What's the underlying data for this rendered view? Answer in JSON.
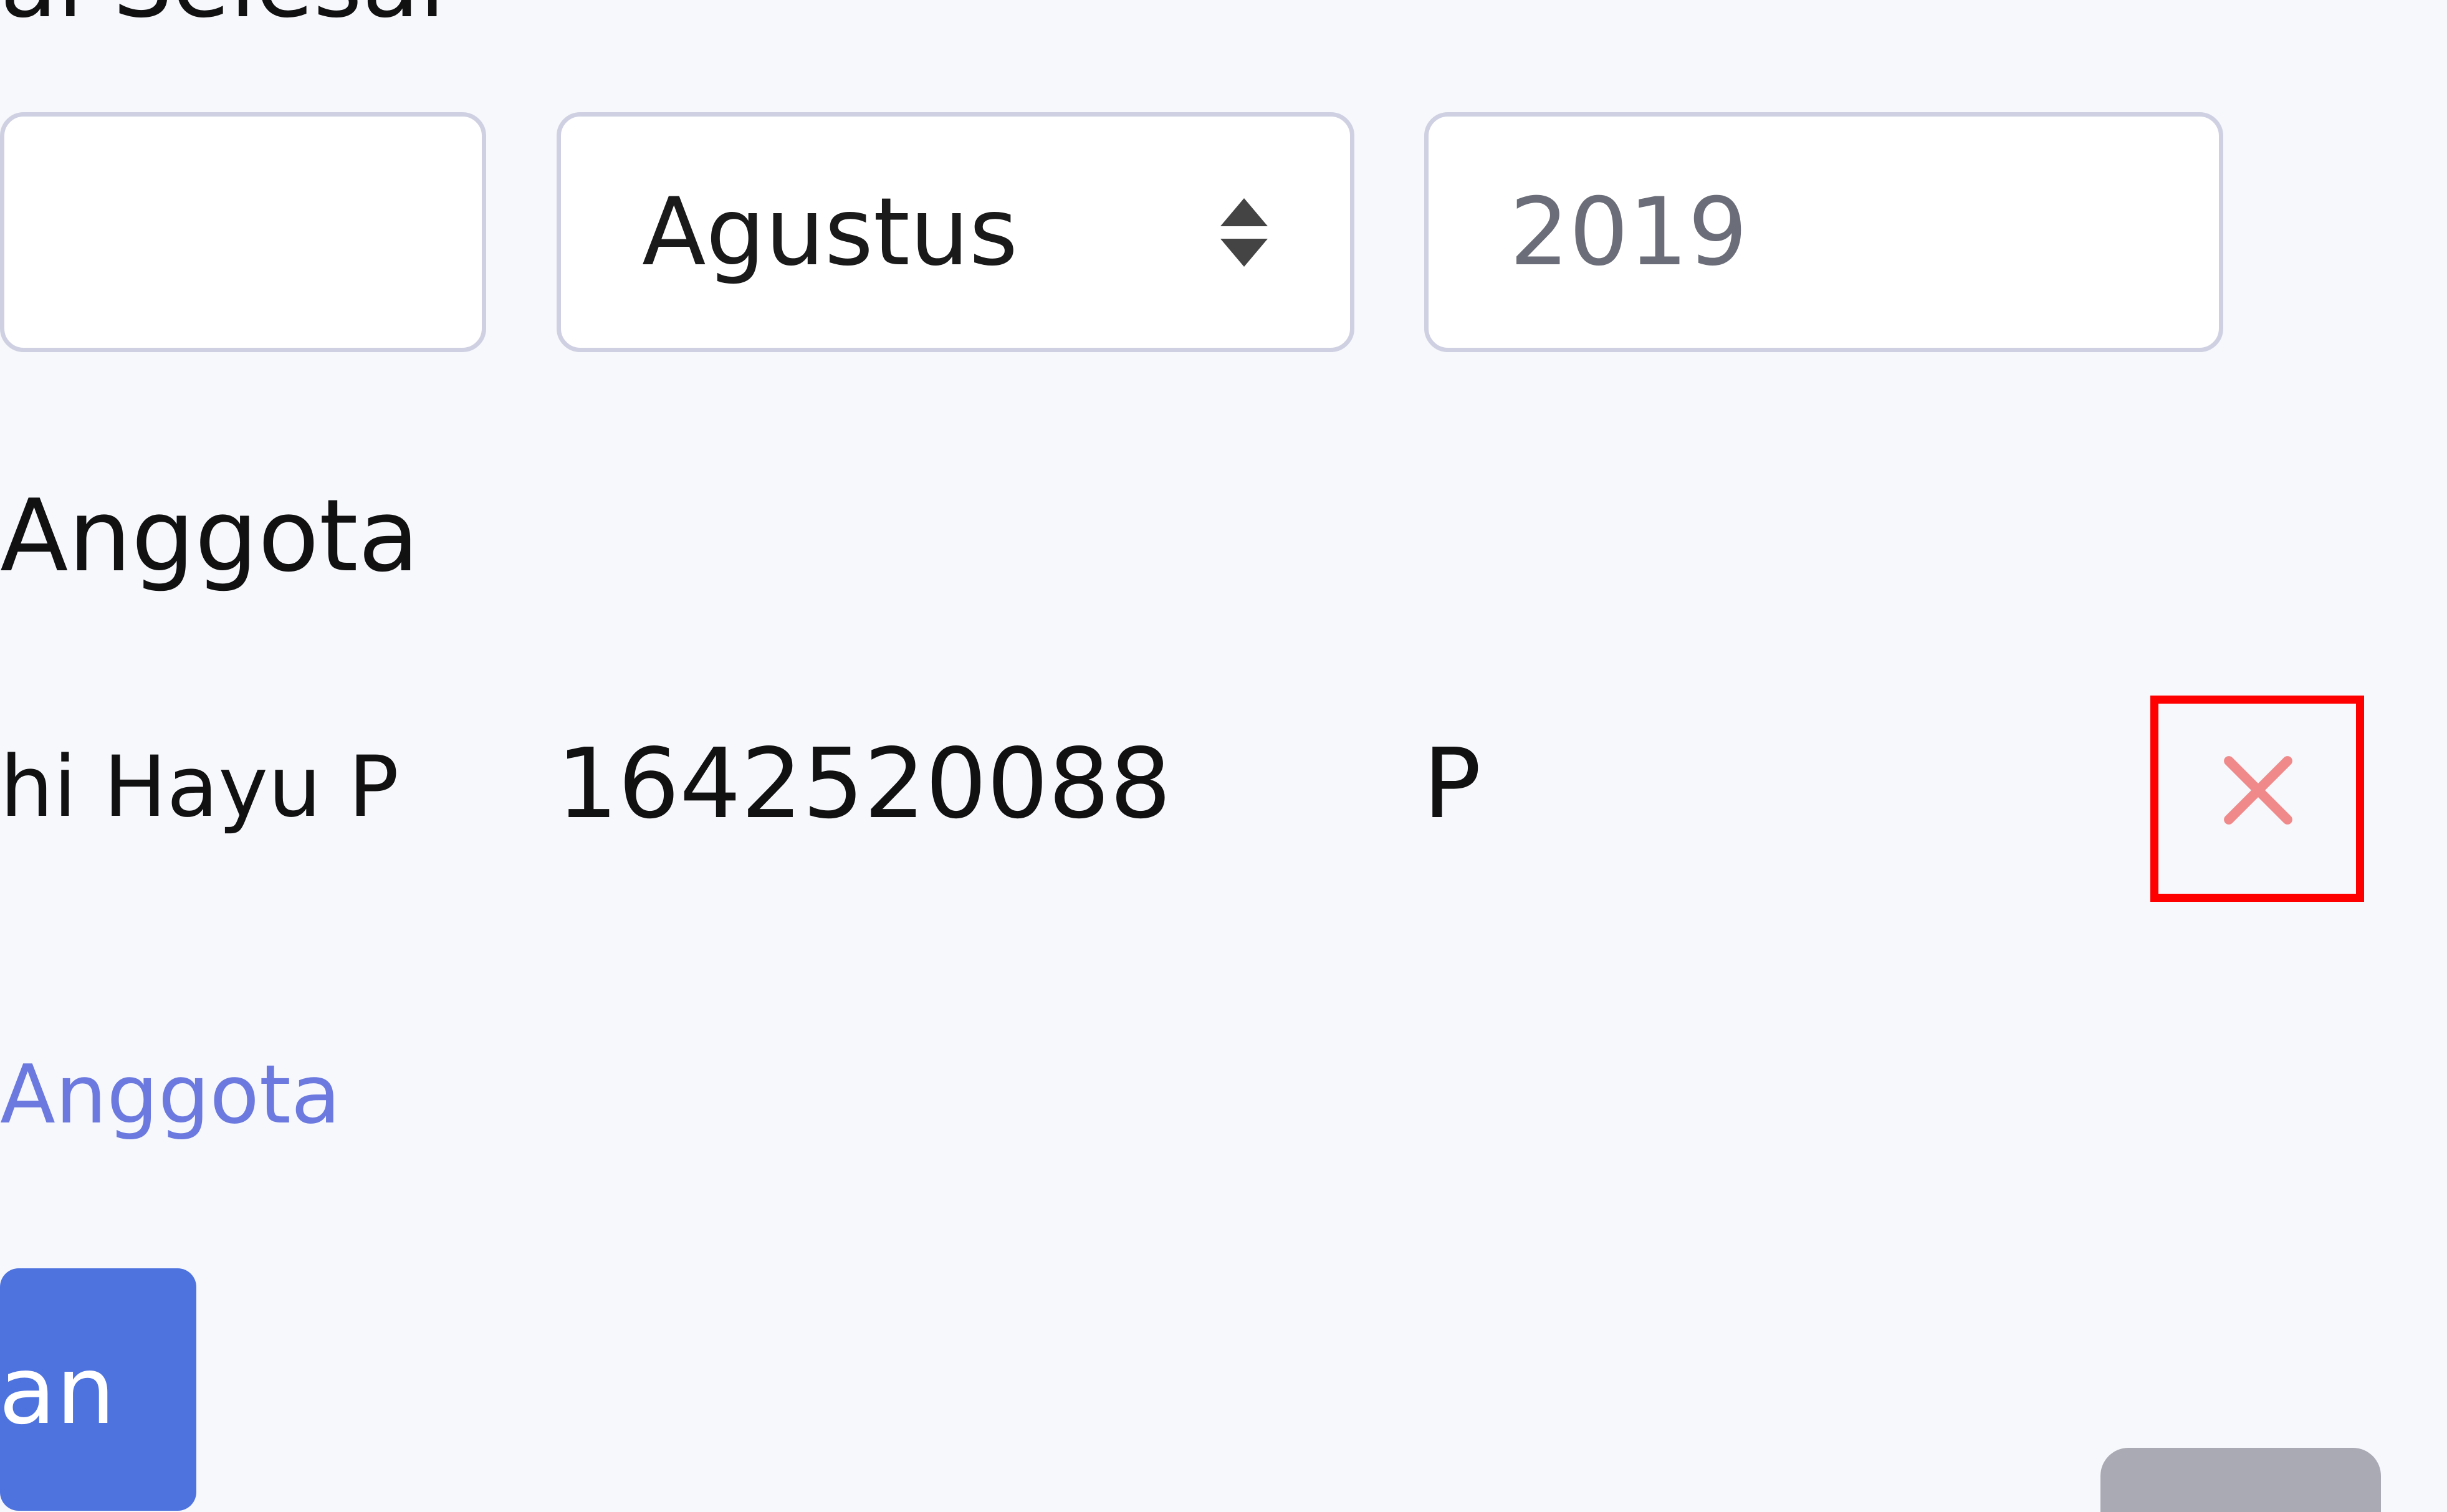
{
  "form": {
    "end_date_label": "ai Selesai",
    "day_value": "",
    "month_value": "Agustus",
    "year_placeholder": "2019",
    "members_heading": "Anggota",
    "members": [
      {
        "name": "hi Hayu P",
        "nim": "1642520088",
        "gender": "P"
      }
    ],
    "add_member_link": "Anggota",
    "submit_label": "an",
    "secondary_label": ""
  },
  "colors": {
    "accent": "#4e73df",
    "link": "#6c7ae0",
    "delete": "#f08a8a",
    "highlight": "#ff0000",
    "secondary": "#aaaab4"
  },
  "icons": {
    "delete": "times-icon",
    "select": "sort-arrows-icon"
  }
}
